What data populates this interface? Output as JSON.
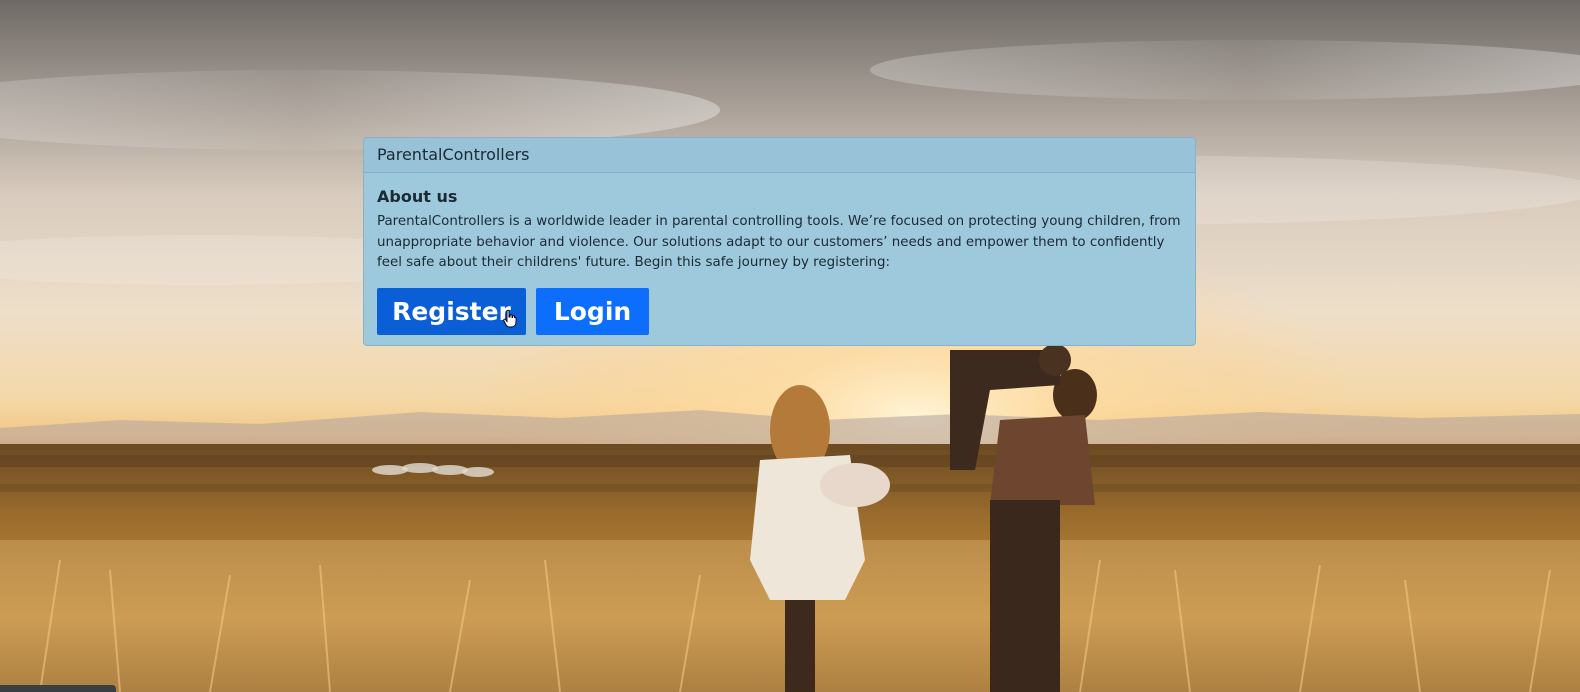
{
  "brand": "ParentalControllers",
  "about": {
    "title": "About us",
    "text": "ParentalControllers is a worldwide leader in parental controlling tools. We’re focused on protecting young children, from unappropriate behavior and violence. Our solutions adapt to our customers’ needs and empower them to confidently feel safe about their childrens' future. Begin this safe journey by registering:"
  },
  "buttons": {
    "register_label": "Register",
    "login_label": "Login"
  },
  "colors": {
    "panel_bg": "#9ec8dc",
    "register_bg": "#0a5ed6",
    "login_bg": "#0d6efd"
  },
  "icons": {
    "cursor": "hand-pointer-icon"
  }
}
